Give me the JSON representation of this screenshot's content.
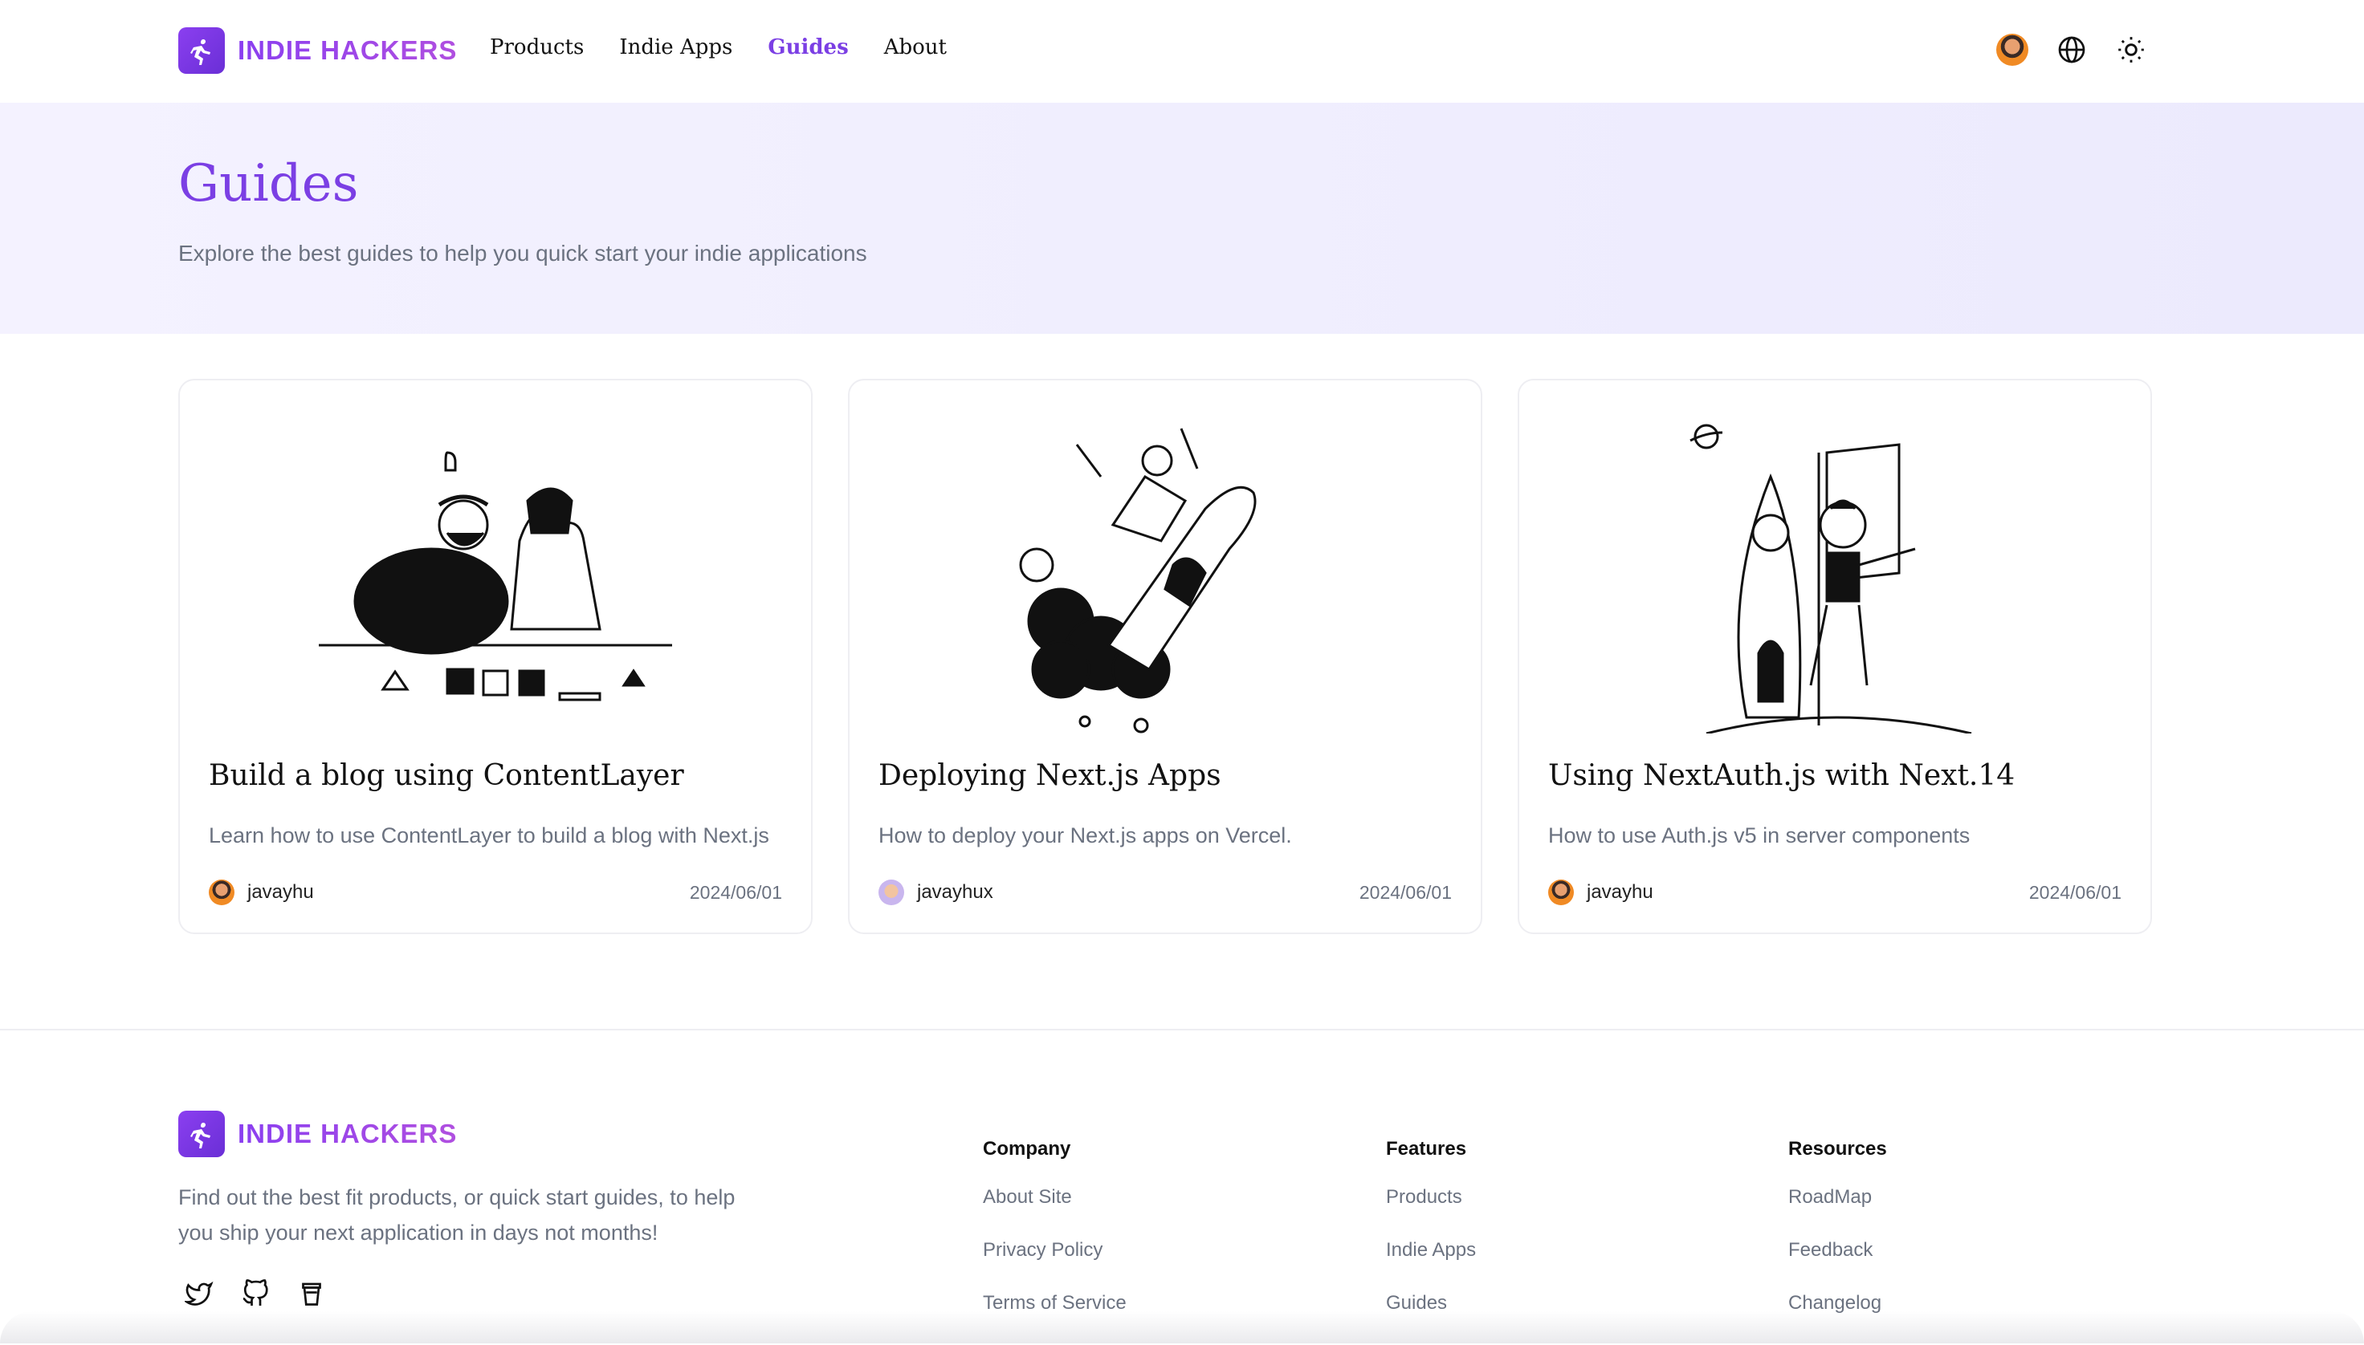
{
  "brand": {
    "name": "INDIE HACKERS",
    "accent": "#7b3fe4"
  },
  "nav": {
    "items": [
      "Products",
      "Indie Apps",
      "Guides",
      "About"
    ],
    "active": "Guides"
  },
  "header_icons": [
    "avatar",
    "globe-icon",
    "sun-icon"
  ],
  "hero": {
    "title": "Guides",
    "subtitle": "Explore the best guides to help you quick start your indie applications"
  },
  "cards": [
    {
      "title": "Build a blog using ContentLayer",
      "desc": "Learn how to use ContentLayer to build a blog with Next.js",
      "author": "javayhu",
      "date": "2024/06/01"
    },
    {
      "title": "Deploying Next.js Apps",
      "desc": "How to deploy your Next.js apps on Vercel.",
      "author": "javayhux",
      "date": "2024/06/01"
    },
    {
      "title": "Using NextAuth.js with Next.14",
      "desc": "How to use Auth.js v5 in server components",
      "author": "javayhu",
      "date": "2024/06/01"
    }
  ],
  "footer": {
    "about": "Find out the best fit products, or quick start guides, to help you ship your next application in days not months!",
    "social": [
      "twitter-icon",
      "github-icon",
      "coffee-icon"
    ],
    "columns": [
      {
        "heading": "Company",
        "links": [
          "About Site",
          "Privacy Policy",
          "Terms of Service"
        ]
      },
      {
        "heading": "Features",
        "links": [
          "Products",
          "Indie Apps",
          "Guides"
        ]
      },
      {
        "heading": "Resources",
        "links": [
          "RoadMap",
          "Feedback",
          "Changelog"
        ]
      }
    ]
  }
}
